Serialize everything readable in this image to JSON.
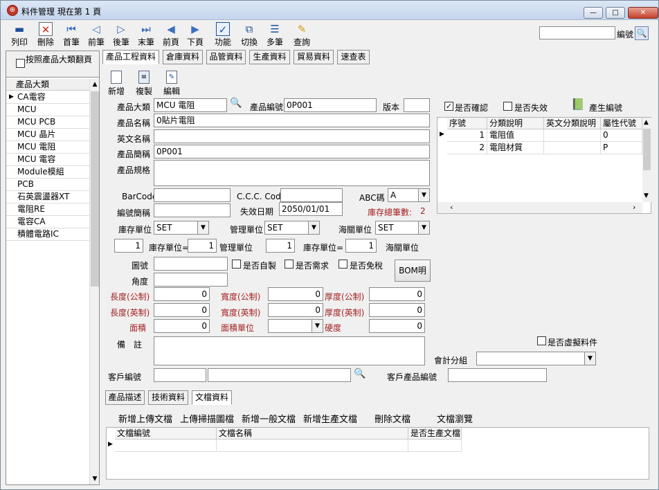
{
  "window": {
    "title": "料件管理  現在第 1 頁",
    "app_icon": "globe-icon",
    "controls": {
      "minimize": "—",
      "maximize": "□",
      "close": "✕"
    }
  },
  "toolbar": {
    "buttons": [
      {
        "label": "列印",
        "icon": "printer-icon"
      },
      {
        "label": "刪除",
        "icon": "delete-icon"
      },
      {
        "label": "首筆",
        "icon": "first-record-icon"
      },
      {
        "label": "前筆",
        "icon": "prev-record-icon"
      },
      {
        "label": "後筆",
        "icon": "next-record-icon"
      },
      {
        "label": "末筆",
        "icon": "last-record-icon"
      },
      {
        "label": "前頁",
        "icon": "prev-page-icon"
      },
      {
        "label": "下頁",
        "icon": "next-page-icon"
      },
      {
        "label": "功能",
        "icon": "function-icon"
      },
      {
        "label": "切換",
        "icon": "switch-icon"
      },
      {
        "label": "多筆",
        "icon": "multi-record-icon"
      },
      {
        "label": "查詢",
        "icon": "query-icon"
      }
    ],
    "search": {
      "value": "",
      "label": "編號",
      "icon": "search-icon"
    }
  },
  "left_panel": {
    "group_checkbox_label": "按照產品大類翻頁",
    "group_checked": false,
    "column_header": "產品大類",
    "categories": [
      "CA電容",
      "MCU",
      "MCU PCB",
      "MCU 晶片",
      "MCU 電阻",
      "MCU 電容",
      "Module模組",
      "PCB",
      "石英震盪器XT",
      "電阻RE",
      "電容CA",
      "積體電路IC"
    ],
    "selected_index": 0
  },
  "main_tabs": [
    "產品工程資料",
    "倉庫資料",
    "品管資料",
    "生產資料",
    "貿易資料",
    "速查表"
  ],
  "active_main_tab": 0,
  "sub_toolbar": [
    {
      "label": "新增",
      "icon": "new-doc-icon"
    },
    {
      "label": "複製",
      "icon": "copy-doc-icon"
    },
    {
      "label": "編輯",
      "icon": "edit-doc-icon"
    }
  ],
  "form": {
    "category_label": "產品大類",
    "category_value": "MCU 電阻",
    "code_label": "產品編號",
    "code_value": "0P001",
    "version_label": "版本",
    "version_value": "",
    "name_label": "產品名稱",
    "name_value": "0貼片電阻",
    "en_name_label": "英文名稱",
    "en_name_value": "",
    "short_label": "產品簡稱",
    "short_value": "0P001",
    "spec_label": "產品規格",
    "spec_value": "",
    "barcode_label": "BarCode",
    "barcode_value": "",
    "ccc_label": "C.C.C. Code",
    "ccc_value": "",
    "abc_label": "ABC碼",
    "abc_value": "A",
    "code_short_label": "編號簡稱",
    "code_short_value": "",
    "expire_label": "失效日期",
    "expire_value": "2050/01/01",
    "stock_count_label": "庫存總筆數:",
    "stock_count_value": "2",
    "stock_unit_label": "庫存單位",
    "stock_unit_value": "SET",
    "mgmt_unit_label": "管理單位",
    "mgmt_unit_value": "SET",
    "customs_unit_label": "海關單位",
    "customs_unit_value": "SET",
    "conv1_value": "1",
    "conv1_label": "庫存單位=",
    "conv2_value": "1",
    "conv2_label": "管理單位",
    "conv3_value": "1",
    "conv3_label": "庫存單位=",
    "conv4_value": "1",
    "conv4_label": "海關單位",
    "drawing_label": "圖號",
    "drawing_value": "",
    "self_made_label": "是否自製",
    "need_label": "是否需求",
    "tax_free_label": "是否免稅",
    "bom_button": "BOM明細",
    "angle_label": "角度",
    "angle_value": "",
    "len_metric_label": "長度(公制)",
    "len_metric_value": "0",
    "wid_metric_label": "寬度(公制)",
    "wid_metric_value": "0",
    "thk_metric_label": "厚度(公制)",
    "thk_metric_value": "0",
    "len_imp_label": "長度(英制)",
    "len_imp_value": "0",
    "wid_imp_label": "寬度(英制)",
    "wid_imp_value": "0",
    "thk_imp_label": "厚度(英制)",
    "thk_imp_value": "0",
    "area_label": "面積",
    "area_value": "0",
    "area_unit_label": "面積單位",
    "area_unit_value": "",
    "hardness_label": "硬度",
    "hardness_value": "0",
    "remark_label": "備　註",
    "remark_value": "",
    "customer_code_label": "客戶編號",
    "customer_code_value": "",
    "customer_name_value": "",
    "customer_product_label": "客戶產品編號",
    "customer_product_value": ""
  },
  "right_panel": {
    "confirmed_label": "是否確認",
    "confirmed": true,
    "invalid_label": "是否失效",
    "invalid": false,
    "gen_code_label": "產生編號",
    "gen_code_icon": "book-check-icon",
    "virtual_label": "是否虛擬料件",
    "virtual": false,
    "account_group_label": "會計分組",
    "account_group_value": "",
    "grid_headers": [
      "序號",
      "分類說明",
      "英文分類說明",
      "屬性代號"
    ],
    "grid_rows": [
      {
        "seq": "1",
        "desc": "電阻值",
        "en_desc": "",
        "code": "0"
      },
      {
        "seq": "2",
        "desc": "電阻材質",
        "en_desc": "",
        "code": "P"
      }
    ]
  },
  "bottom_tabs": [
    "產品描述",
    "技術資料",
    "文檔資料"
  ],
  "active_bottom_tab": 2,
  "doc_actions": [
    "新增上傳文檔",
    "上傳掃描圖檔",
    "新增一般文檔",
    "新增生產文檔",
    "刪除文檔",
    "文檔瀏覽"
  ],
  "doc_grid_headers": [
    "文檔編號",
    "文檔名稱",
    "是否生產文檔"
  ]
}
